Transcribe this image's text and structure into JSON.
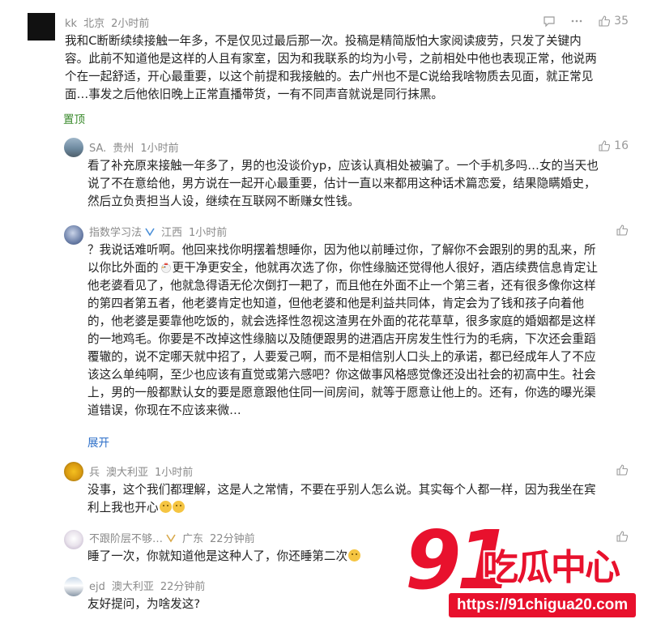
{
  "comments": [
    {
      "user": "kk",
      "location": "北京",
      "time": "2小时前",
      "likes": "35",
      "text": "我和C断断续续接触一年多，不是仅见过最后那一次。投稿是精简版怕大家阅读疲劳，只发了关键内容。此前不知道他是这样的人且有家室，因为和我联系的均为小号，之前相处中他也表现正常，他说两个在一起舒适，开心最重要，以这个前提和我接触的。去广州也不是C说给我啥物质去见面，就正常见面…事发之后他依旧晚上正常直播带货，一有不同声音就说是同行抹黑。",
      "pin_label": "置顶"
    },
    {
      "user": "SA.",
      "location": "贵州",
      "time": "1小时前",
      "likes": "16",
      "text": "看了补充原来接触一年多了，男的也没谈价yp，应该认真相处被骗了。一个手机多吗…女的当天也说了不在意给他，男方说在一起开心最重要，估计一直以来都用这种话术篇恋爱，结果隐瞒婚史，然后立负责担当人设，继续在互联网不断赚女性钱。"
    },
    {
      "user": "指数学习法",
      "location": "江西",
      "time": "1小时前",
      "text_before_emoji": "？我说话难听啊。他回来找你明摆着想睡你，因为他以前睡过你，了解你不会跟别的男的乱来，所以你比外面的",
      "text_after_emoji": "更干净更安全，他就再次选了你，你性缘脑还觉得他人很好，酒店续费信息肯定让他老婆看见了，他就急得语无伦次倒打一耙了，而且他在外面不止一个第三者，还有很多像你这样的第四者第五者，他老婆肯定也知道，但他老婆和他是利益共同体，肯定会为了钱和孩子向着他的，他老婆是要靠他吃饭的，就会选择性忽视这渣男在外面的花花草草，很多家庭的婚姻都是这样的一地鸡毛。你要是不改掉这性缘脑以及随便跟男的进酒店开房发生性行为的毛病，下次还会重蹈覆辙的，说不定哪天就中招了，人要爱己啊，而不是相信别人口头上的承诺，都已经成年人了不应该这么单纯啊，至少也应该有直觉或第六感吧？你这做事风格感觉像还没出社会的初高中生。社会上，男的一般都默认女的要是愿意跟他住同一间房间，就等于愿意让他上的。还有，你选的曝光渠道错误，你现在不应该来微…",
      "expand_label": "展开"
    },
    {
      "user": "兵",
      "location": "澳大利亚",
      "time": "1小时前",
      "text": "没事，这个我们都理解，这是人之常情，不要在乎别人怎么说。其实每个人都一样，因为我坐在宾利上我也开心"
    },
    {
      "user": "不跟阶层不够…",
      "location": "广东",
      "time": "22分钟前",
      "text": "睡了一次，你就知道他是这种人了，你还睡第二次"
    },
    {
      "user": "ejd",
      "location": "澳大利亚",
      "time": "22分钟前",
      "text": "友好提问，为啥发这?"
    }
  ],
  "watermark": {
    "logo_number": "91",
    "logo_text": "吃瓜中心",
    "url": "https://91chigua20.com"
  },
  "colors": {
    "pin": "#3a8a2c",
    "expand": "#2d6fc9",
    "watermark": "#e8112d",
    "meta": "#8a8a8a"
  },
  "icons": [
    "comment-icon",
    "more-icon",
    "thumbs-up-icon",
    "verified-icon",
    "rooster-emoji",
    "smile-emoji",
    "laugh-emoji"
  ]
}
